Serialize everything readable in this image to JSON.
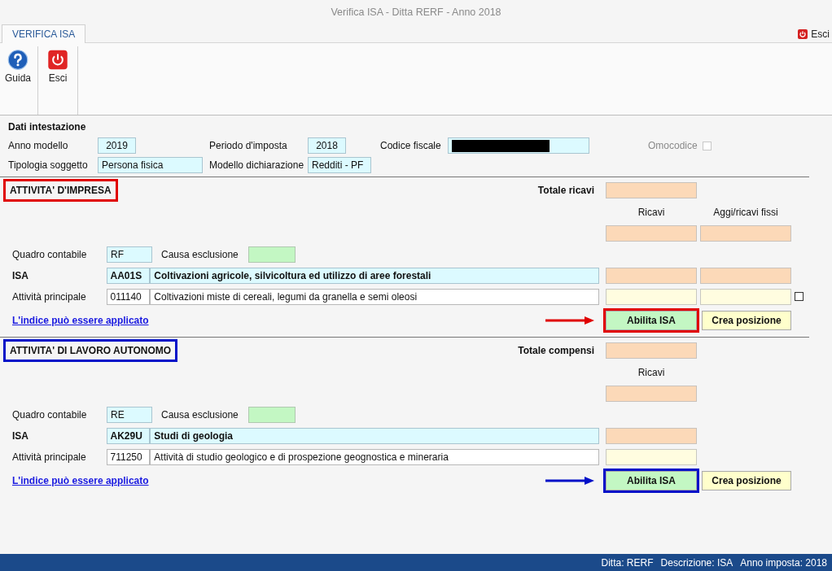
{
  "window": {
    "title": "Verifica ISA - Ditta RERF - Anno 2018"
  },
  "tabs": [
    {
      "label": "VERIFICA ISA",
      "selected": true
    }
  ],
  "exit_link": {
    "label": "Esci"
  },
  "ribbon": [
    {
      "kind": "help",
      "label": "Guida"
    },
    {
      "kind": "exit",
      "label": "Esci"
    }
  ],
  "header": {
    "title": "Dati intestazione",
    "anno_modello": {
      "label": "Anno modello",
      "value": "2019"
    },
    "periodo": {
      "label": "Periodo d'imposta",
      "value": "2018"
    },
    "codice_fiscale": {
      "label": "Codice fiscale"
    },
    "omocodice": {
      "label": "Omocodice",
      "checked": false
    },
    "tipologia": {
      "label": "Tipologia soggetto",
      "value": "Persona fisica"
    },
    "modello": {
      "label": "Modello dichiarazione",
      "value": "Redditi - PF"
    }
  },
  "sections": [
    {
      "title": "ATTIVITA' D'IMPRESA",
      "color": "#e00000",
      "total_label": "Totale ricavi",
      "columns": [
        "Ricavi",
        "Aggi/ricavi fissi"
      ],
      "quadro": {
        "label": "Quadro contabile",
        "value": "RF"
      },
      "causa_label": "Causa esclusione",
      "isa": {
        "label": "ISA",
        "code": "AA01S",
        "description": "Coltivazioni agricole, silvicoltura ed utilizzo di aree forestali"
      },
      "attivita": {
        "label": "Attività principale",
        "code": "011140",
        "description": "Coltivazioni miste di cereali, legumi da granella e semi oleosi"
      },
      "extra_checkbox": {
        "checked": false
      },
      "link": "L'indice può essere applicato",
      "buttons": [
        "Abilita ISA",
        "Crea posizione"
      ]
    },
    {
      "title": "ATTIVITA' DI LAVORO AUTONOMO",
      "color": "#0010c8",
      "total_label": "Totale compensi",
      "columns": [
        "Ricavi"
      ],
      "quadro": {
        "label": "Quadro contabile",
        "value": "RE"
      },
      "causa_label": "Causa esclusione",
      "isa": {
        "label": "ISA",
        "code": "AK29U",
        "description": "Studi di geologia"
      },
      "attivita": {
        "label": "Attività principale",
        "code": "711250",
        "description": "Attività di studio geologico e di prospezione geognostica e mineraria"
      },
      "link": "L'indice può essere applicato",
      "buttons": [
        "Abilita ISA",
        "Crea posizione"
      ]
    }
  ],
  "status_bar": [
    "Ditta: RERF",
    "Descrizione: ISA",
    "Anno imposta: 2018"
  ]
}
